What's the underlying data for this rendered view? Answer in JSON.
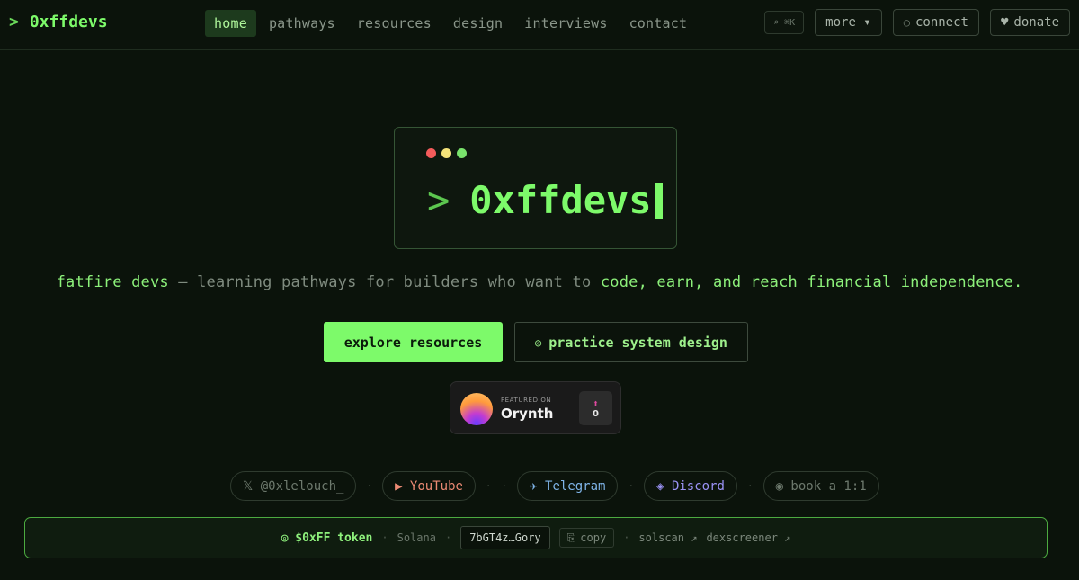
{
  "header": {
    "brand_prompt": ">",
    "brand_name": "0xffdevs",
    "nav": [
      {
        "label": "home",
        "active": true
      },
      {
        "label": "pathways"
      },
      {
        "label": "resources"
      },
      {
        "label": "design"
      },
      {
        "label": "interviews"
      },
      {
        "label": "contact"
      }
    ],
    "search_shortcut": "⌕ ⌘K",
    "more_label": "more ▾",
    "connect_icon": "○",
    "connect_label": "connect",
    "donate_icon": "♥",
    "donate_label": "donate"
  },
  "hero": {
    "prompt": ">",
    "title": "0xffdevs"
  },
  "tagline": {
    "part1": "fatfire devs",
    "part2": " — learning pathways for builders who want to ",
    "part3": "code, earn, and reach financial independence."
  },
  "cta": {
    "primary_label": "explore resources",
    "secondary_icon": "◎",
    "secondary_label": "practice system design"
  },
  "featured": {
    "small_label": "FEATURED ON",
    "name": "Orynth",
    "upvote_arrow": "⬆",
    "upvote_count": "0"
  },
  "social": {
    "x_label": "𝕏 @0xlelouch_",
    "youtube_label": "▶ YouTube",
    "telegram_label": "✈ Telegram",
    "discord_label": "◈ Discord",
    "book_label": "◉ book a 1:1",
    "separator": "·"
  },
  "token": {
    "icon": "◎",
    "name": "$0xFF token",
    "network": "Solana",
    "address": "7bGT4z…Gory",
    "copy_icon": "⎘",
    "copy_label": "copy",
    "solscan_label": "solscan ↗",
    "dexscreener_label": "dexscreener ↗",
    "separator": "·"
  },
  "colors": {
    "accent": "#7dfa6a",
    "background": "#0b130b",
    "token_border": "#4caa40"
  }
}
